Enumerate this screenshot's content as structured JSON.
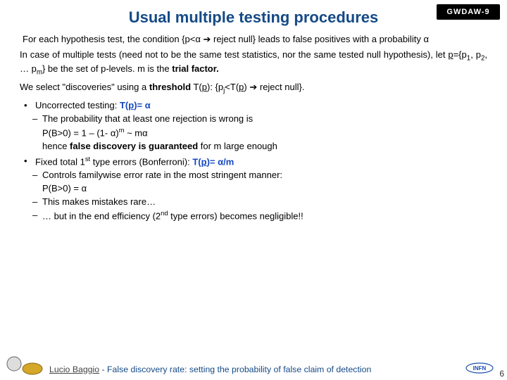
{
  "title": "Usual multiple testing procedures",
  "badge": "GWDAW-9",
  "p1a": "For each hypothesis test, the condition {p<",
  "alpha": "α",
  "arrow": " ➔ ",
  "p1b": "reject null} leads to false positives with a probability ",
  "p2a": "In case of multiple tests (need not to be the same test statistics, nor the same tested null hypothesis), let ",
  "pvec": "p",
  "p2b": "={p",
  "sub1": "1",
  "p2c": ", p",
  "sub2": "2",
  "p2d": ", … p",
  "subm": "m",
  "p2e": "} be the set of p-levels. m is the ",
  "trialfactor": "trial factor.",
  "p3a": "We select \"discoveries\" using a ",
  "threshold": "threshold",
  "p3b": " T(",
  "p3c": "): {p",
  "subj": "j",
  "p3d": "<T(",
  "p3e": ")",
  "rejectnull": " reject null}.",
  "b1": "Uncorrected testing: ",
  "tpe": "T(",
  "tpeq": ")= ",
  "s1": "The probability that at least one rejection is wrong is",
  "eq1a": "P(B>0) = 1 – (1- ",
  "eq1b": ")",
  "supm": "m",
  "eq1c": " ~ m",
  "s2a": "hence ",
  "s2b": "false discovery is guaranteed",
  "s2c": " for m large enough",
  "b2a": "Fixed total 1",
  "supst": "st",
  "b2b": " type errors (Bonferroni): ",
  "tpm": "/m",
  "s3": "Controls familywise error rate in the most stringent manner:",
  "eq2": "P(B>0) = ",
  "s4": "This makes mistakes rare…",
  "s5a": "… but in the end efficiency (2",
  "supnd": "nd",
  "s5b": " type errors) becomes negligible!!",
  "author": "Lucio Baggio",
  "footer": " - False discovery rate: setting the probability of false claim of detection",
  "pagenum": "6",
  "infn": "INFN"
}
